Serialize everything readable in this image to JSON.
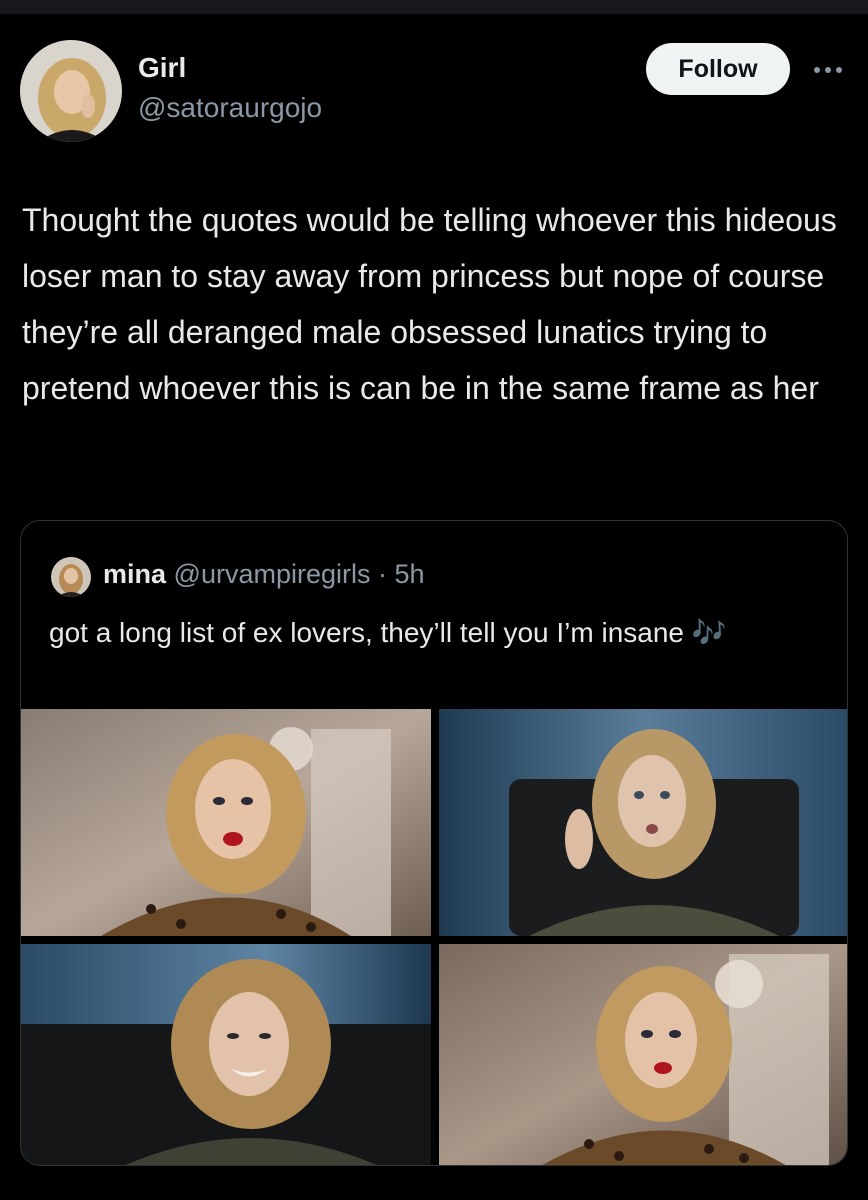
{
  "post": {
    "author_name": "Girl",
    "author_handle": "@satoraurgojo",
    "follow_label": "Follow",
    "text": "Thought the quotes would be telling whoever this hideous loser man to stay away from princess but nope of course they’re all deranged male obsessed lunatics trying to pretend whoever this is can be in the same frame as her"
  },
  "quote": {
    "author_name": "mina",
    "author_handle": "@urvampiregirls",
    "separator": " · ",
    "time": "5h",
    "text": "got a long list of ex lovers, they’ll tell you I’m insane 🎶"
  },
  "icons": {
    "more": "more-options-icon"
  },
  "colors": {
    "background": "#000000",
    "text": "#e7e9ea",
    "secondary_text": "#8b98a5",
    "border": "#2f3336",
    "follow_button": "#eff3f4"
  }
}
